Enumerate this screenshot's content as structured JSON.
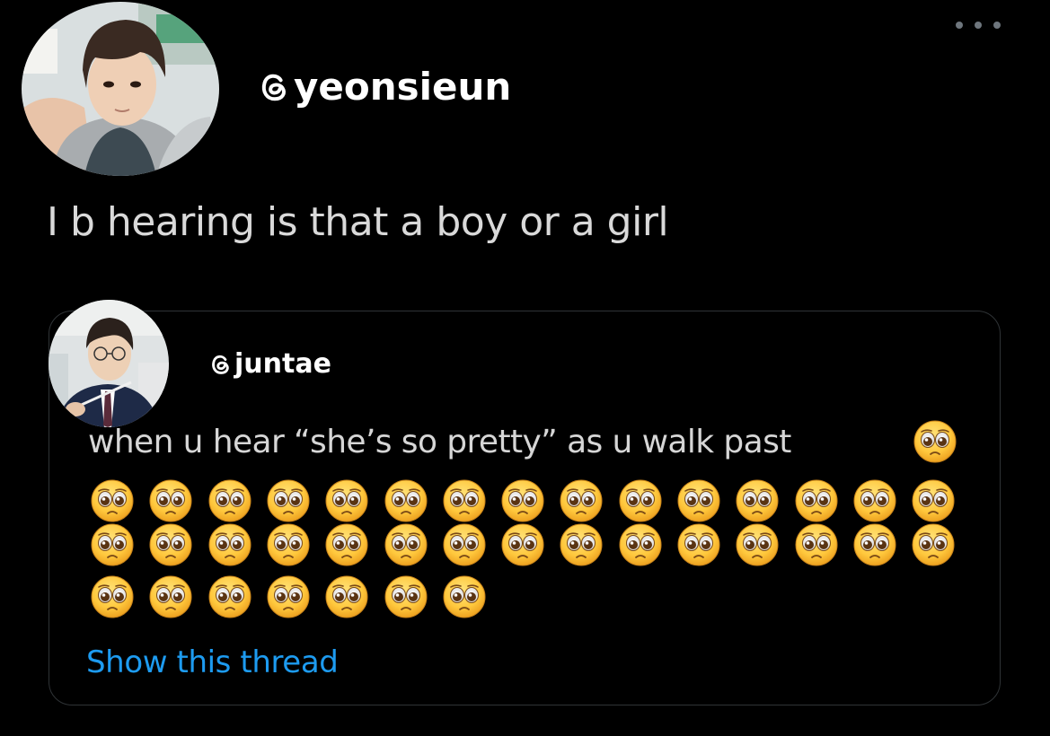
{
  "post": {
    "handle": "yeonsieun",
    "text": "I b hearing is that a boy or a girl",
    "avatar_icon": "profile-photo",
    "more_icon": "more-dots-icon",
    "handle_icon": "threads-logo-icon"
  },
  "quoted": {
    "handle": "juntae",
    "text": "when u hear “she’s so pretty” as u walk past",
    "avatar_icon": "profile-photo",
    "handle_icon": "threads-logo-icon",
    "emoji_name": "pleading-face-emoji",
    "emoji_count": 38,
    "show_thread_label": "Show this thread"
  },
  "colors": {
    "background": "#000000",
    "text": "#d9d9d9",
    "link": "#1d9bf0",
    "border": "#2f3336",
    "emoji_face": "#ffc83d"
  }
}
